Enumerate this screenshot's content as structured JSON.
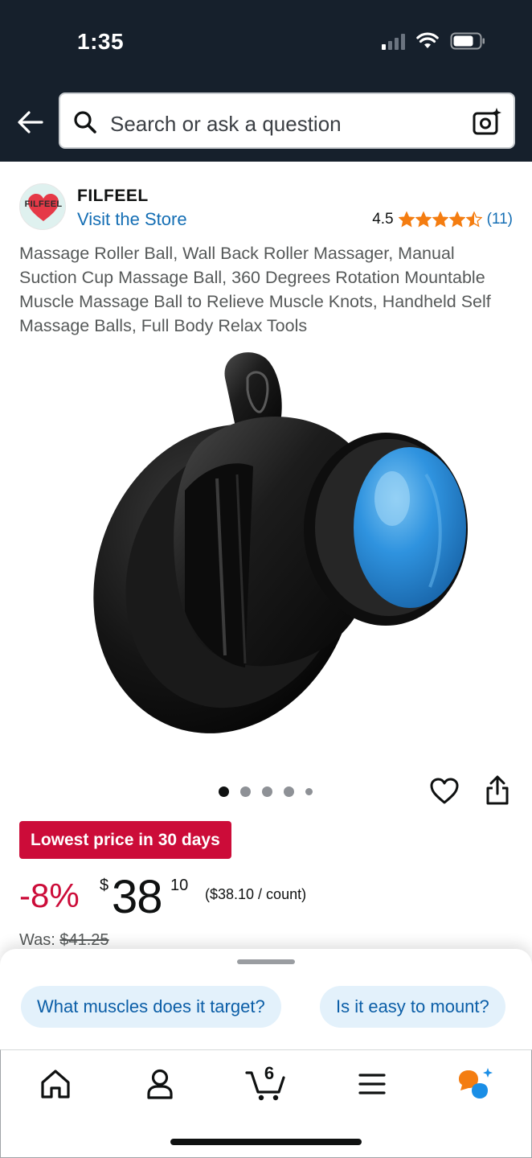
{
  "status_bar": {
    "time": "1:35"
  },
  "search": {
    "placeholder": "Search or ask a question"
  },
  "brand": {
    "logo_text": "FILFEEL",
    "name": "FILFEEL",
    "visit_store": "Visit the Store"
  },
  "rating": {
    "value": "4.5",
    "count": "(11)",
    "stars": 4.5
  },
  "product": {
    "title": "Massage Roller Ball, Wall Back Roller Massager, Manual Suction Cup Massage Ball, 360 Degrees Rotation Mountable Muscle Massage Ball to Relieve Muscle Knots, Handheld Self Massage Balls, Full Body Relax Tools",
    "image_count": 5,
    "active_image": 1
  },
  "deal": {
    "badge": "Lowest price in 30 days"
  },
  "price": {
    "discount": "-8%",
    "currency": "$",
    "whole": "38",
    "fraction": "10",
    "unit": "($38.10 / count)",
    "was_label": "Was: ",
    "was_value": "$41.25"
  },
  "suggestions": [
    "What muscles does it target?",
    "Is it easy to mount?"
  ],
  "nav": {
    "cart_count": "6"
  },
  "colors": {
    "header_bg": "#16202c",
    "deal_red": "#cc0c39",
    "link_blue": "#146eb4",
    "star_orange": "#f47d11",
    "chip_bg": "#e3f1fb"
  }
}
